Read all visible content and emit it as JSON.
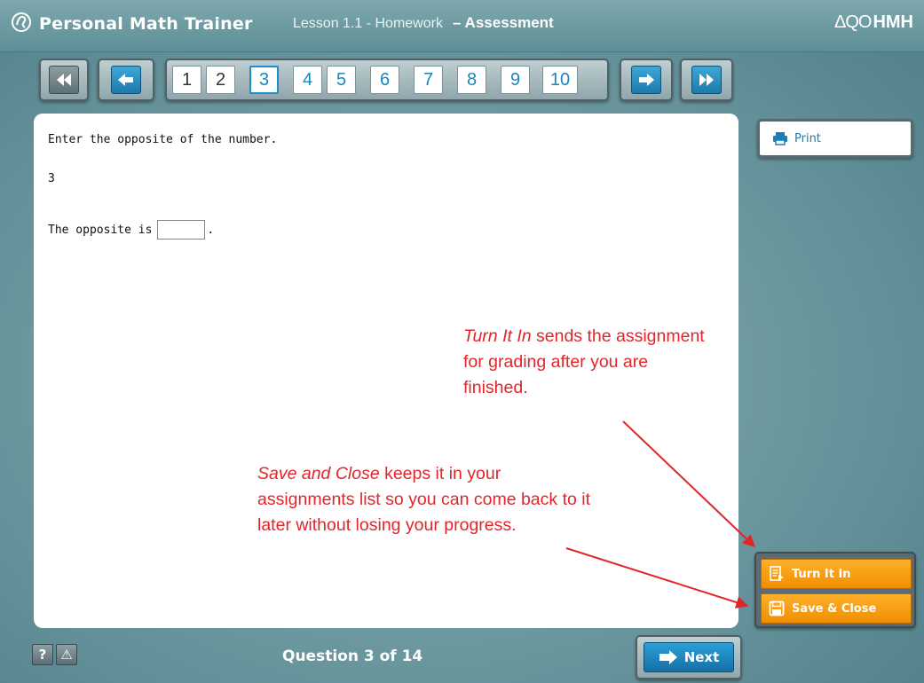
{
  "header": {
    "app_title": "Personal Math Trainer",
    "lesson": "Lesson 1.1 - Homework",
    "mode": "– Assessment",
    "publisher": "HMH",
    "publisher_mark": "ΔQO"
  },
  "nav": {
    "first_icon": "double-left-arrow-icon",
    "prev_icon": "left-arrow-icon",
    "next_icon": "right-arrow-icon",
    "last_icon": "double-right-arrow-icon",
    "questions": [
      "1",
      "2",
      "3",
      "4",
      "5",
      "6",
      "7",
      "8",
      "9",
      "10"
    ],
    "active_question": "3"
  },
  "question": {
    "prompt": "Enter the opposite of the number.",
    "number": "3",
    "answer_label": "The opposite is",
    "answer_suffix": ".",
    "answer_value": ""
  },
  "annotations": {
    "turn_in_em": "Turn It In",
    "turn_in_rest": " sends the assignment for grading after you are finished.",
    "save_em": "Save and Close",
    "save_rest": " keeps it in your assignments list so you can come back to it later without losing your progress.",
    "color": "#e0262b"
  },
  "sidebar": {
    "print_label": "Print",
    "turn_in_label": "Turn It In",
    "save_close_label": "Save & Close"
  },
  "footer": {
    "help_label": "?",
    "alert_label": "⚠",
    "question_count": "Question 3 of 14",
    "next_label": "Next"
  },
  "colors": {
    "accent_blue": "#1a86bd",
    "action_orange": "#f39a0a",
    "background_teal": "#6f9aa2"
  }
}
